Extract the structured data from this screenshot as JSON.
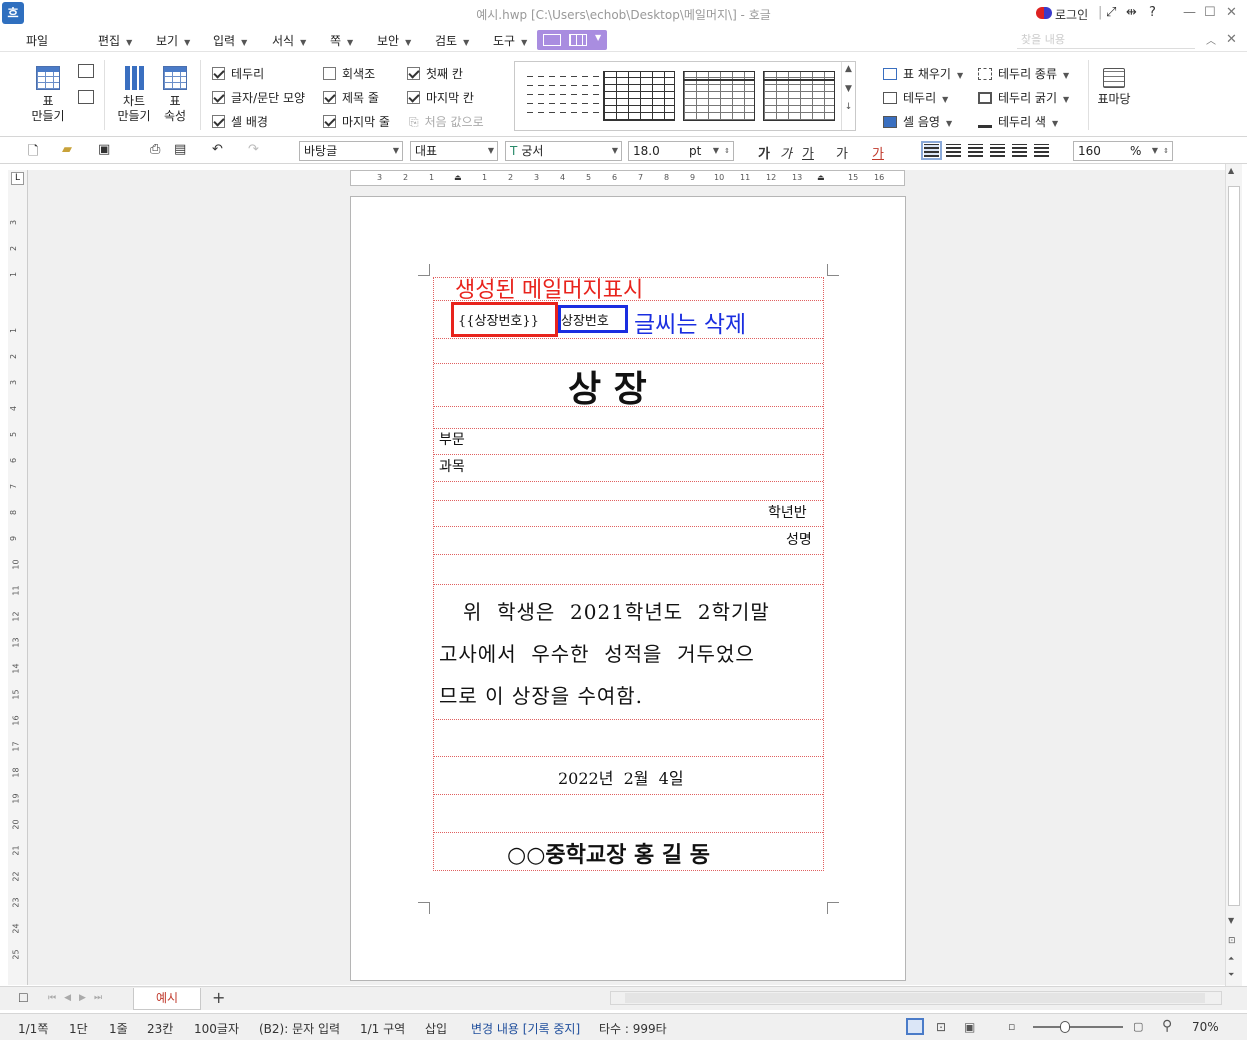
{
  "window": {
    "app_icon": "흐",
    "title": "예시.hwp [C:\\Users\\echob\\Desktop\\메일머지\\] - 호글",
    "login_label": "로그인",
    "help": "?"
  },
  "menu": {
    "items": [
      "파일",
      "편집",
      "보기",
      "입력",
      "서식",
      "쪽",
      "보안",
      "검토",
      "도구"
    ],
    "search_placeholder": "찾을 내용"
  },
  "ribbon": {
    "table_make": "표\n만들기",
    "chart_make": "차트\n만들기",
    "table_props": "표\n속성",
    "checks": [
      {
        "label": "테두리",
        "checked": true
      },
      {
        "label": "글자/문단 모양",
        "checked": true
      },
      {
        "label": "셀 배경",
        "checked": true
      },
      {
        "label": "회색조",
        "checked": false
      },
      {
        "label": "제목 줄",
        "checked": true
      },
      {
        "label": "마지막 줄",
        "checked": true
      },
      {
        "label": "첫째 칸",
        "checked": true
      },
      {
        "label": "마지막 칸",
        "checked": true
      }
    ],
    "reset_label": "처음 값으로",
    "fill_label": "표 채우기",
    "border_label": "테두리",
    "cell_shade_label": "셀 음영",
    "border_type_label": "테두리 종류",
    "border_width_label": "테두리 굵기",
    "border_color_label": "테두리 색",
    "table_yard_label": "표마당"
  },
  "format": {
    "style": "바탕글",
    "lang": "대표",
    "font": "궁서",
    "size": "18.0",
    "unit": "pt",
    "zoom": "160",
    "zoom_unit": "%"
  },
  "document": {
    "annotation_red": "생성된    메일머지표시",
    "merge_field": "{{상장번호}}",
    "label_field": "상장번호",
    "annotation_blue": "글씨는    삭제",
    "heading": "상    장",
    "dept": "부문",
    "subject": "과목",
    "class": "학년반",
    "name": "성명",
    "body_line1": "위  학생은  2021학년도  2학기말",
    "body_line2": "고사에서  우수한  성적을  거두었으",
    "body_line3": "므로 이 상장을 수여함.",
    "date": "2022년  2월  4일",
    "signer": "○○중학교장 홍 길 동"
  },
  "tabs": {
    "doc_tab": "예시",
    "add": "+"
  },
  "status": {
    "page": "1/1쪽",
    "section": "1단",
    "line": "1줄",
    "col": "23칸",
    "chars": "100글자",
    "cell": "(B2): 문자 입력",
    "zone": "1/1 구역",
    "insert": "삽입",
    "track": "변경 내용 [기록 중지]",
    "typing": "타수 : 999타",
    "zoom": "70%"
  },
  "ruler": {
    "h_ticks": [
      "3",
      "2",
      "1",
      "1",
      "1",
      "2",
      "3",
      "4",
      "5",
      "6",
      "7",
      "8",
      "9",
      "10",
      "11",
      "12",
      "13",
      "14",
      "15",
      "16"
    ],
    "v_ticks": [
      "3",
      "2",
      "1",
      "1",
      "2",
      "3",
      "4",
      "5",
      "6",
      "7",
      "8",
      "9",
      "10",
      "11",
      "12",
      "13",
      "14",
      "15",
      "16",
      "17",
      "18",
      "19",
      "20",
      "21",
      "22",
      "23",
      "24",
      "25"
    ]
  },
  "colors": {
    "accent": "#a98de0",
    "red_annot": "#e8231c",
    "blue_annot": "#1a2ee0",
    "table_border": "#e06060"
  }
}
